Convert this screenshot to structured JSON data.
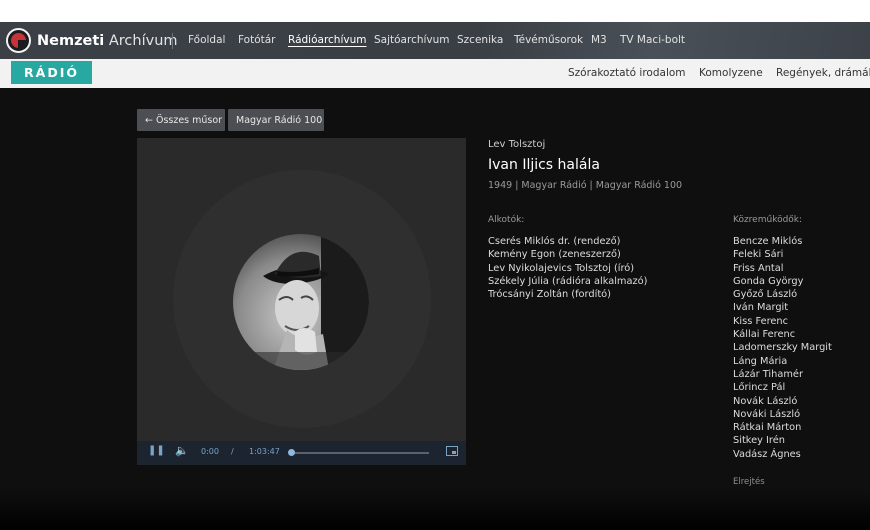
{
  "site": {
    "logo_bold": "Nemzeti",
    "logo_rest": " Archívum"
  },
  "nav": [
    "Főoldal",
    "Fotótár",
    "Rádióarchívum",
    "Sajtóarchívum",
    "Szcenika",
    "Tévéműsorok",
    "M3",
    "TV Maci-bolt"
  ],
  "nav_active": "Rádióarchívum",
  "subnav": {
    "badge": "RÁDIÓ",
    "items": [
      "Szórakoztató irodalom",
      "Komolyzene",
      "Regények, drámák"
    ]
  },
  "buttons": {
    "back": "Összes műsor",
    "series": "Magyar Rádió 100"
  },
  "player": {
    "current_time": "0:00",
    "separator": "/",
    "duration": "1:03:47",
    "progress": 0
  },
  "program": {
    "author": "Lev Tolsztoj",
    "title": "Ivan Iljics halála",
    "meta": "1949 | Magyar Rádió | Magyar Rádió 100"
  },
  "creators": {
    "heading": "Alkotók:",
    "items": [
      "Cserés Miklós dr. (rendező)",
      "Kemény Egon (zeneszerző)",
      "Lev Nyikolajevics Tolsztoj (író)",
      "Székely Júlia (rádióra alkalmazó)",
      "Trócsányi Zoltán (fordító)"
    ]
  },
  "contributors": {
    "heading": "Közreműködők:",
    "items": [
      "Bencze Miklós",
      "Feleki Sári",
      "Friss Antal",
      "Gonda György",
      "Győző László",
      "Iván Margit",
      "Kiss Ferenc",
      "Kállai Ferenc",
      "Ladomerszky Margit",
      "Láng Mária",
      "Lázár Tihamér",
      "Lőrincz Pál",
      "Novák László",
      "Nováki László",
      "Rátkai Márton",
      "Sitkey Irén",
      "Vadász Ágnes"
    ],
    "hide_label": "Elrejtés"
  },
  "colors": {
    "accent": "#27a8a0",
    "brand_red": "#c6343a",
    "nav_bg": "#3b4046"
  }
}
